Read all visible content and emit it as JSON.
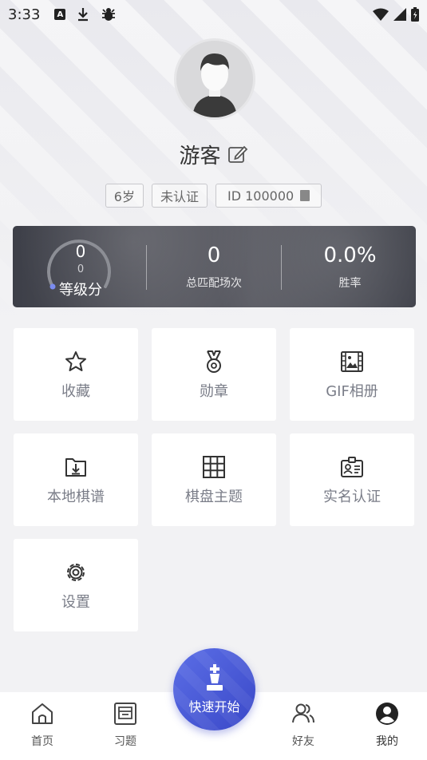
{
  "status_bar": {
    "time": "3:33"
  },
  "profile": {
    "username": "游客",
    "tags": {
      "age": "6岁",
      "verify": "未认证",
      "id": "ID  100000"
    }
  },
  "stats": {
    "rating_value": "0",
    "rating_sub": "0",
    "rating_label": "等级分",
    "matches_value": "0",
    "matches_label": "总匹配场次",
    "winrate_value": "0.0%",
    "winrate_label": "胜率"
  },
  "grid": {
    "favorites": "收藏",
    "medals": "勋章",
    "gif_album": "GIF相册",
    "local_records": "本地棋谱",
    "board_theme": "棋盘主题",
    "real_name": "实名认证",
    "settings": "设置"
  },
  "bottom_nav": {
    "home": "首页",
    "exercises": "习题",
    "quick_start": "快速开始",
    "friends": "好友",
    "mine": "我的"
  },
  "colors": {
    "accent": "#4656d6",
    "card_bg": "#ffffff",
    "page_bg": "#f2f2f4",
    "label_gray": "#7a7d88"
  }
}
